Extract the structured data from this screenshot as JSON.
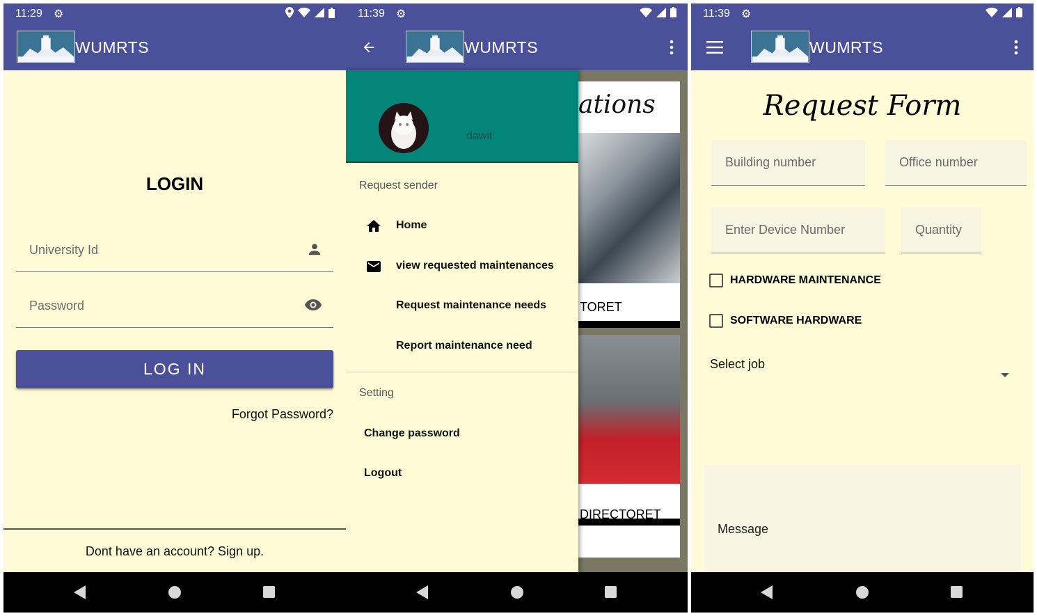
{
  "app_title": "WUMRTS",
  "colors": {
    "primary": "#4a519a",
    "background": "#fffbd6",
    "drawer_header": "#04857a"
  },
  "screen1": {
    "status_time": "11:29",
    "heading": "LOGIN",
    "university_id_placeholder": "University Id",
    "password_placeholder": "Password",
    "login_button": "LOG IN",
    "forgot_password": "Forgot Password?",
    "signup_text": "Dont have an account? Sign up."
  },
  "screen2": {
    "status_time": "11:39",
    "username": "dawit",
    "section_request": "Request sender",
    "menu": [
      {
        "label": "Home",
        "icon": "home-icon"
      },
      {
        "label": "view requested maintenances",
        "icon": "mail-icon"
      },
      {
        "label": "Request maintenance needs",
        "icon": ""
      },
      {
        "label": "Report maintenance need",
        "icon": ""
      }
    ],
    "section_setting": "Setting",
    "setting_menu": [
      "Change password",
      "Logout"
    ],
    "background_cards": {
      "heading_partial": "ations",
      "card1_label": "TORET",
      "card2_label": "DIRECTORET"
    }
  },
  "screen3": {
    "status_time": "11:39",
    "heading": "Request Form",
    "building_placeholder": "Building number",
    "office_placeholder": "Office number",
    "device_placeholder": "Enter Device Number",
    "quantity_placeholder": "Quantity",
    "checkbox_hardware": "HARDWARE MAINTENANCE",
    "checkbox_software": "SOFTWARE HARDWARE",
    "checkbox_hardware_checked": false,
    "checkbox_software_checked": false,
    "select_job": "Select job",
    "message_placeholder": "Message"
  }
}
